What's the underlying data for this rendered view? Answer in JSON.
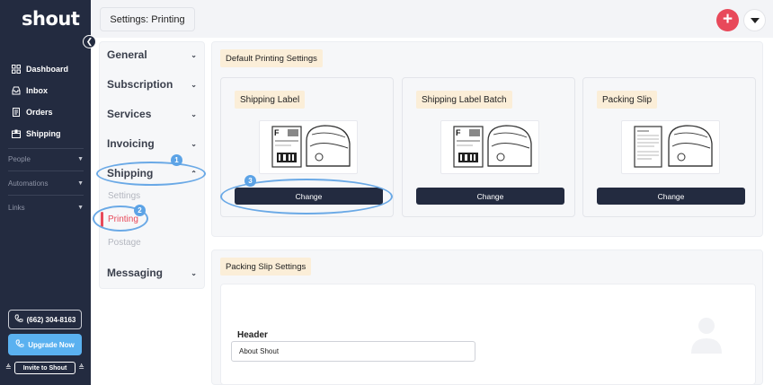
{
  "app": {
    "logo_text": "shout"
  },
  "sidebar": {
    "items": [
      {
        "label": "Dashboard",
        "icon": "grid-icon"
      },
      {
        "label": "Inbox",
        "icon": "inbox-icon"
      },
      {
        "label": "Orders",
        "icon": "receipt-icon"
      },
      {
        "label": "Shipping",
        "icon": "box-icon"
      }
    ],
    "sections": [
      {
        "label": "People"
      },
      {
        "label": "Automations"
      },
      {
        "label": "Links"
      }
    ],
    "phone_label": "(662) 304-8163",
    "upgrade_label": "Upgrade Now",
    "invite_label": "Invite to Shout"
  },
  "header": {
    "title": "Settings: Printing"
  },
  "settings_menu": {
    "general": "General",
    "subscription": "Subscription",
    "services": "Services",
    "invoicing": "Invoicing",
    "shipping": "Shipping",
    "shipping_sub": [
      "Settings",
      "Printing",
      "Postage"
    ],
    "messaging": "Messaging"
  },
  "default_printing": {
    "title": "Default Printing Settings",
    "cards": [
      {
        "label": "Shipping Label",
        "button": "Change"
      },
      {
        "label": "Shipping Label Batch",
        "button": "Change"
      },
      {
        "label": "Packing Slip",
        "button": "Change"
      }
    ]
  },
  "packing_slip": {
    "title": "Packing Slip Settings",
    "header_label": "Header",
    "header_value": "About Shout"
  },
  "annotations": [
    "1",
    "2",
    "3"
  ],
  "colors": {
    "sidebar": "#232b40",
    "accent": "#e8495a",
    "annotation": "#6aa9e6",
    "tag": "#fbeed8"
  }
}
